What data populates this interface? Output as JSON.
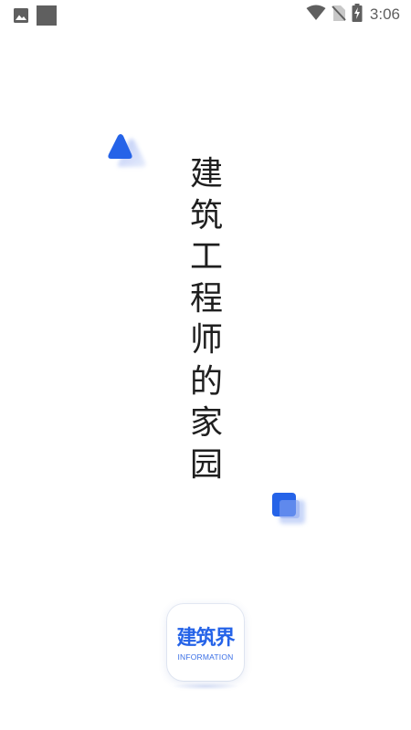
{
  "status_bar": {
    "time": "3:06",
    "left_icons": [
      "image-icon",
      "app-square-icon"
    ],
    "right_icons": [
      "wifi-icon",
      "no-sim-icon",
      "battery-charging-icon"
    ]
  },
  "splash": {
    "slogan_chars": [
      "建",
      "筑",
      "工",
      "程",
      "师",
      "的",
      "家",
      "园"
    ],
    "logo_title": "建筑界",
    "logo_subtitle": "INFORMATION"
  },
  "colors": {
    "accent": "#2563e8",
    "text": "#1f1f1f",
    "status_icon": "#5f5f5f"
  }
}
